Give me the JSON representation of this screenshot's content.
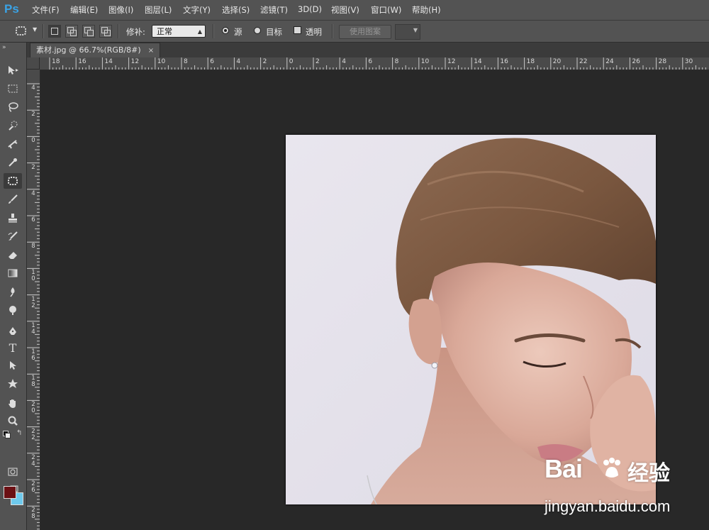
{
  "app": {
    "logo": "Ps"
  },
  "menu": [
    "文件(F)",
    "编辑(E)",
    "图像(I)",
    "图层(L)",
    "文字(Y)",
    "选择(S)",
    "滤镜(T)",
    "3D(D)",
    "视图(V)",
    "窗口(W)",
    "帮助(H)"
  ],
  "options": {
    "patch_label": "修补:",
    "patch_mode": "正常",
    "radio_source": "源",
    "radio_target": "目标",
    "transparent": "透明",
    "use_pattern": "使用图案"
  },
  "tools": [
    "move-tool",
    "marquee-tool",
    "lasso-tool",
    "quick-select-tool",
    "crop-tool",
    "eyedropper-tool",
    "patch-tool",
    "brush-tool",
    "clone-stamp-tool",
    "history-brush-tool",
    "eraser-tool",
    "gradient-tool",
    "blur-tool",
    "dodge-tool",
    "pen-tool",
    "type-tool",
    "path-select-tool",
    "shape-tool",
    "hand-tool",
    "zoom-tool"
  ],
  "colors": {
    "foreground": "#6b1014",
    "background": "#6ec9ec",
    "accent": "#3aa3e6"
  },
  "document": {
    "tab_title": "素材.jpg @ 66.7%(RGB/8#)",
    "close": "×"
  },
  "ruler_top": [
    "18",
    "16",
    "14",
    "12",
    "10",
    "8",
    "6",
    "4",
    "2",
    "0",
    "2",
    "4",
    "6",
    "8",
    "10",
    "12",
    "14",
    "16",
    "18",
    "20",
    "22",
    "24",
    "26",
    "28",
    "30"
  ],
  "ruler_left": [
    "4",
    "2",
    "0",
    "2",
    "4",
    "6",
    "8",
    "1\n0",
    "1\n2",
    "1\n4",
    "1\n6",
    "1\n8",
    "2\n0",
    "2\n2",
    "2\n4",
    "2\n6",
    "2\n8"
  ],
  "watermark": {
    "brand": "Bai",
    "brand2": "经验",
    "url": "jingyan.baidu.com"
  }
}
